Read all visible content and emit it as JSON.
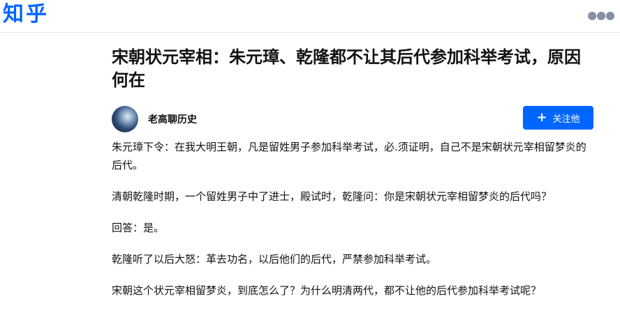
{
  "header": {
    "logo": "知乎",
    "more_icon": "more-icon"
  },
  "article": {
    "title": "宋朝状元宰相：朱元璋、乾隆都不让其后代参加科举考试，原因何在",
    "author": {
      "name": "老高聊历史",
      "avatar_icon": "avatar"
    },
    "follow_button": {
      "icon": "plus-icon",
      "label": "关注他"
    },
    "paragraphs": [
      "朱元璋下令：在我大明王朝，凡是留姓男子参加科举考试，必.须证明，自己不是宋朝状元宰相留梦炎的后代。",
      "清朝乾隆时期，一个留姓男子中了进士，殿试时，乾隆问：你是宋朝状元宰相留梦炎的后代吗？",
      "回答：是。",
      "乾隆听了以后大怒：革去功名，以后他们的后代，严禁参加科举考试。",
      "宋朝这个状元宰相留梦炎，到底怎么了？为什么明清两代，都不让他的后代参加科举考试呢？"
    ]
  },
  "colors": {
    "brand": "#0066ff",
    "text": "#121212",
    "muted": "#8590a6"
  }
}
